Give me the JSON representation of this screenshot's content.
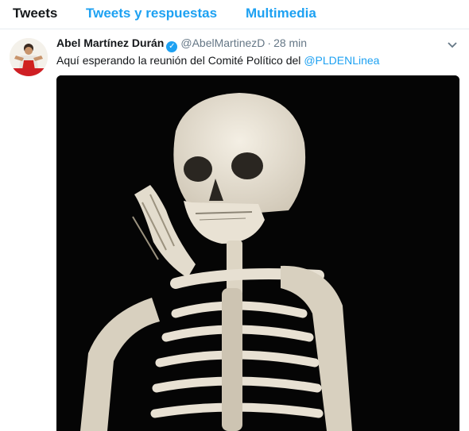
{
  "tabs": [
    {
      "label": "Tweets",
      "active": true
    },
    {
      "label": "Tweets y respuestas",
      "active": false
    },
    {
      "label": "Multimedia",
      "active": false
    }
  ],
  "tweet": {
    "author_name": "Abel Martínez Durán",
    "handle": "@AbelMartinezD",
    "separator": "·",
    "time": "28 min",
    "text_before": "Aquí esperando la reunión del Comité Político del ",
    "mention": "@PLDENLinea",
    "verified_icon": "verified-badge-icon",
    "menu_icon": "chevron-down-icon",
    "media_icon": "skeleton-photo",
    "colors": {
      "accent": "#1da1f2",
      "text": "#14171a",
      "muted": "#657786"
    }
  }
}
